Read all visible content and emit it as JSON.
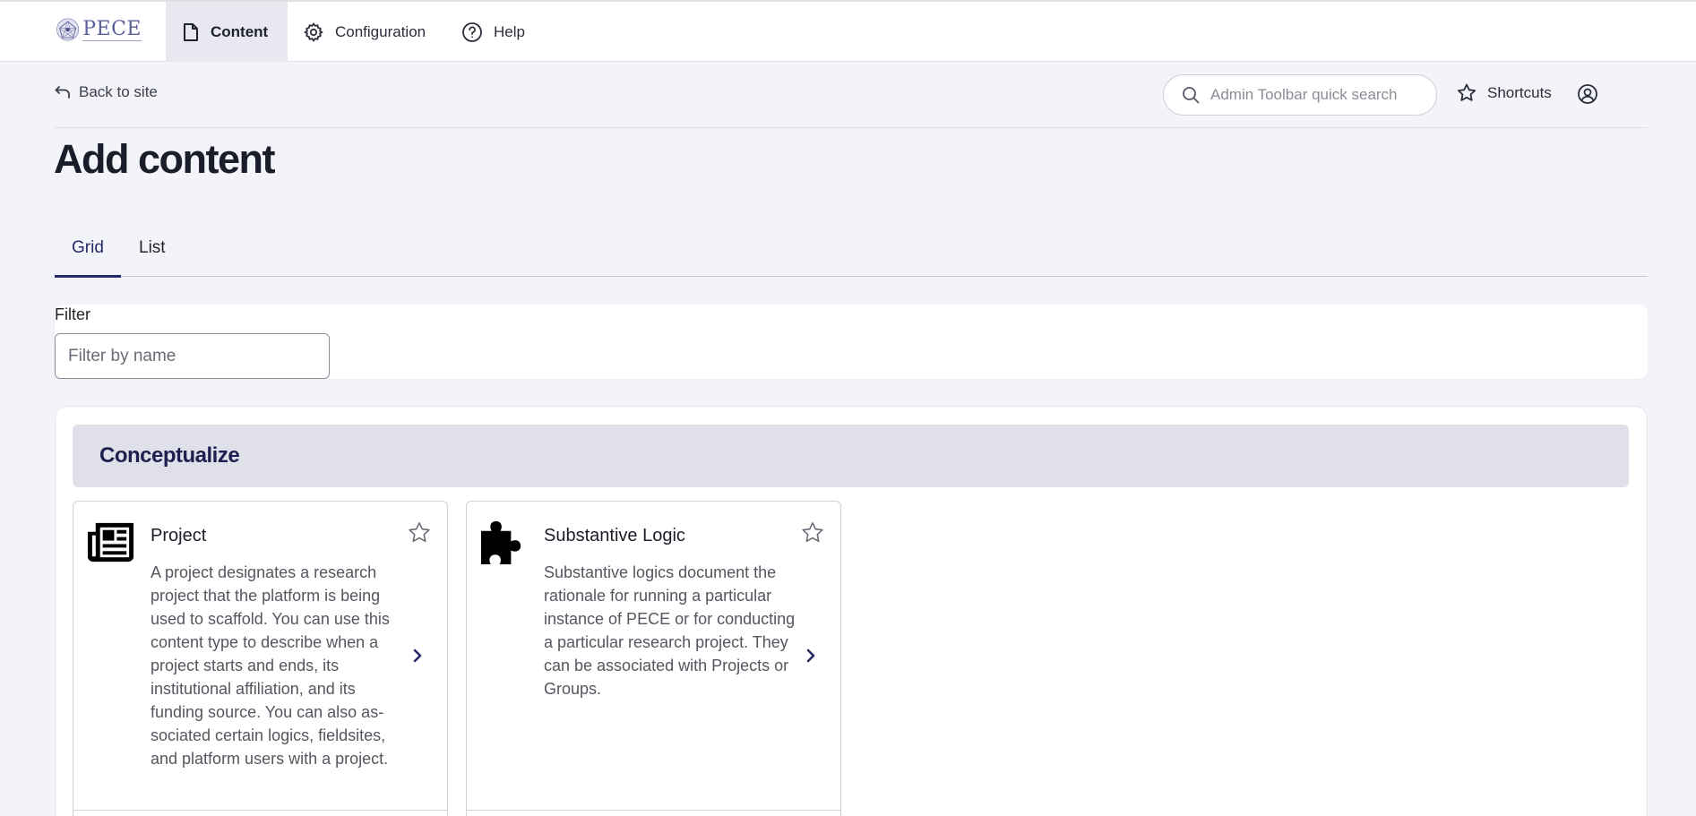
{
  "toolbar": {
    "logo_text": "PECE",
    "nav": {
      "content": "Content",
      "configuration": "Configuration",
      "help": "Help"
    }
  },
  "subbar": {
    "back_label": "Back to site",
    "search_placeholder": "Admin Toolbar quick search",
    "shortcuts_label": "Shortcuts"
  },
  "page": {
    "title": "Add content",
    "tabs": [
      {
        "label": "Grid",
        "active": true
      },
      {
        "label": "List",
        "active": false
      }
    ]
  },
  "filter": {
    "label": "Filter",
    "placeholder": "Filter by name"
  },
  "section": {
    "title": "Conceptualize",
    "cards": [
      {
        "title": "Project",
        "icon": "newspaper-icon",
        "description": "A project designates a research project that the platform is being used to scaffold. You can use this content type to describe when a project starts and ends, its institutional affiliation, and its funding source. You can also as­sociated certain logics, fieldsites, and platform users with a project."
      },
      {
        "title": "Substantive Logic",
        "icon": "puzzle-piece-icon",
        "description": "Substantive logics document the rationale for running a particular instance of PECE or for conduct­ing a particular research project. They can be associated with Projects or Groups."
      }
    ]
  },
  "colors": {
    "accent": "#262a66",
    "section_bg": "#dfe0e9",
    "page_bg": "#f3f4f9"
  }
}
